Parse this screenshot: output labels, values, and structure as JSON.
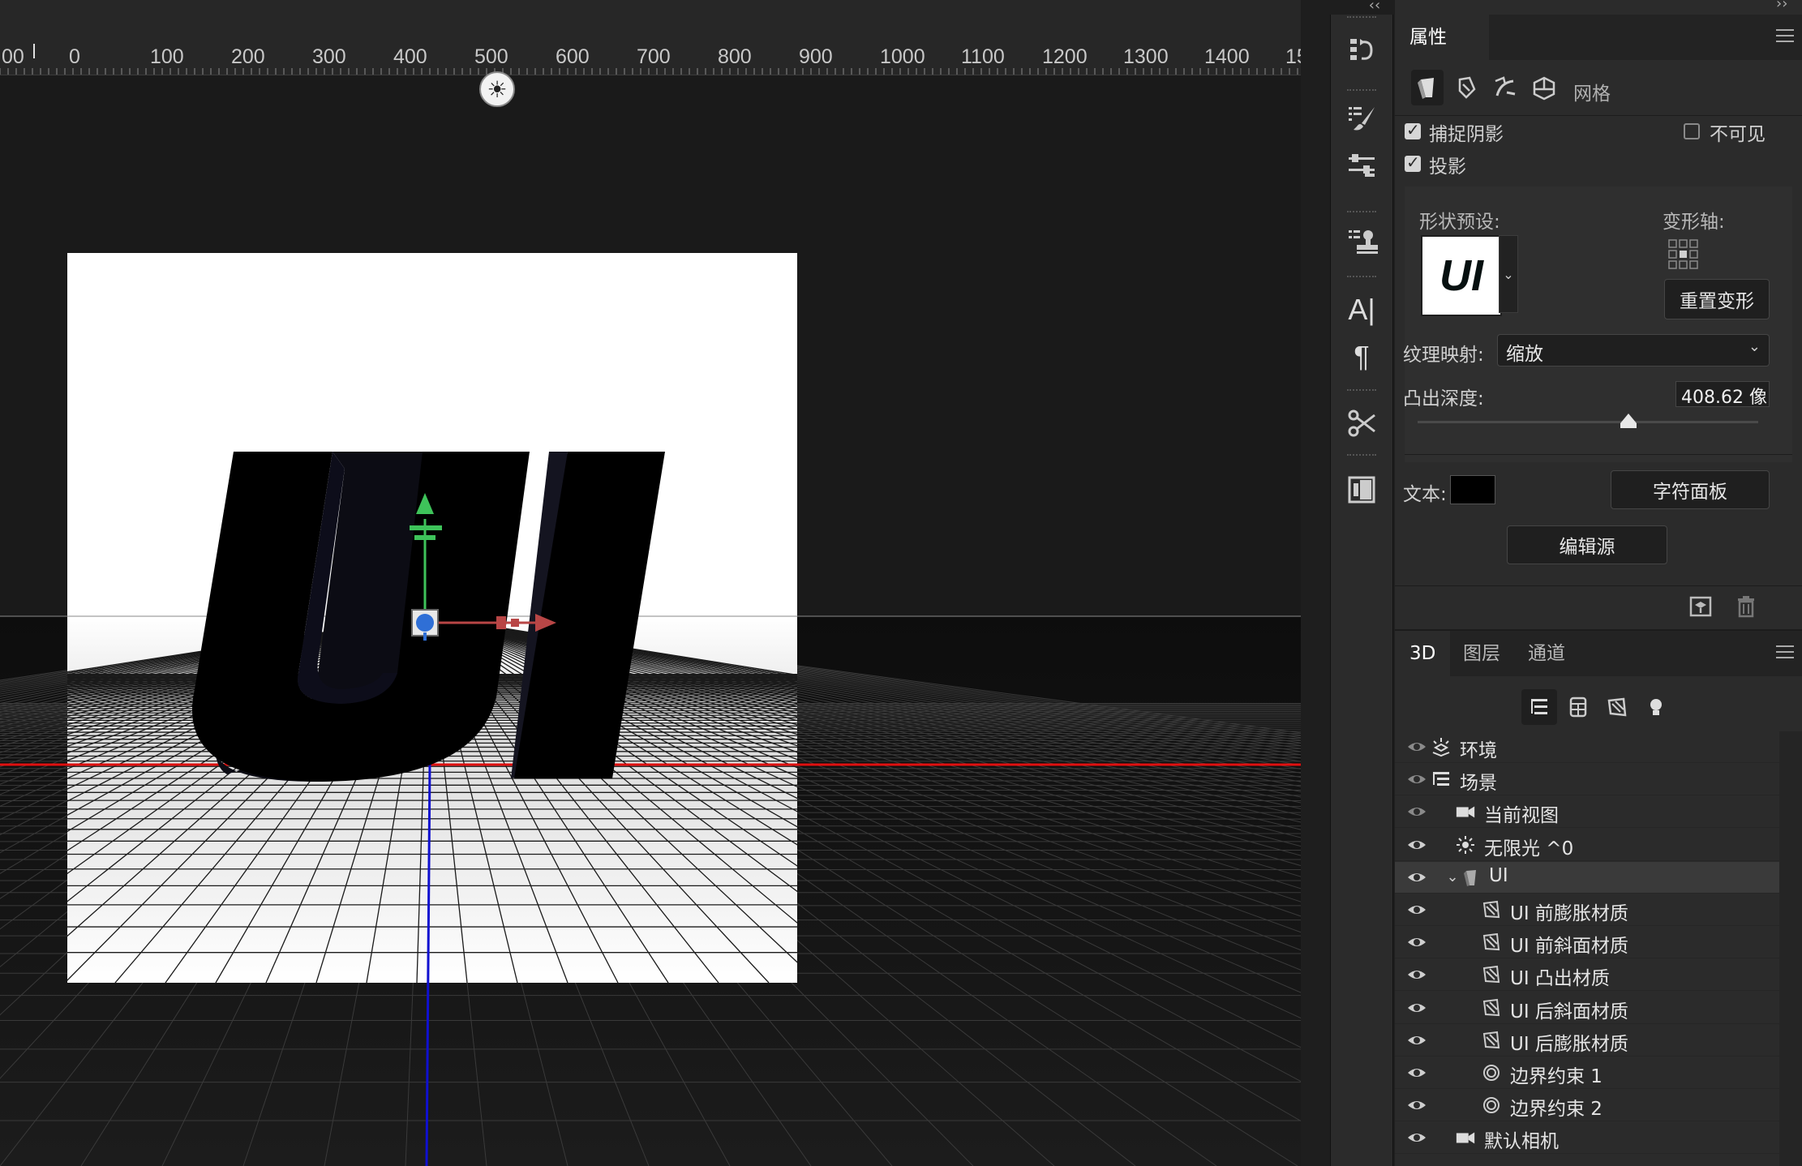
{
  "ruler": {
    "labels": [
      "00",
      "0",
      "100",
      "200",
      "300",
      "400",
      "500",
      "600",
      "700",
      "800",
      "900",
      "1000",
      "1100",
      "1200",
      "1300",
      "1400",
      "15"
    ]
  },
  "scene": {
    "text_3d": "UI",
    "colors": {
      "horizon_red": "#e01010",
      "vertical_blue": "#1010d0",
      "gizmo_green": "#3ec35a",
      "gizmo_red": "#b84646",
      "gizmo_blue": "#2f6fd6"
    }
  },
  "toolstrip": {
    "collapse_left": "‹‹",
    "tools": [
      "history-brush-icon",
      "brush-presets-icon",
      "adjust-sliders-icon",
      "clone-source-icon",
      "character-icon",
      "paragraph-icon",
      "3d-tools-icon",
      "libraries-icon"
    ]
  },
  "properties": {
    "title": "属性",
    "collapse_right": "››",
    "mode_icons": [
      "mesh-icon",
      "deform-icon",
      "cap-icon",
      "coordinates-icon"
    ],
    "mode_label": "网格",
    "catch_shadows": {
      "label": "捕捉阴影",
      "checked": true
    },
    "invisible": {
      "label": "不可见",
      "checked": false
    },
    "cast_shadows": {
      "label": "投影",
      "checked": true
    },
    "shape_preset_label": "形状预设:",
    "shape_preset_thumb": "UI",
    "deform_axis_label": "变形轴:",
    "reset_deform": "重置变形",
    "texture_mapping_label": "纹理映射:",
    "texture_mapping_value": "缩放",
    "extrusion_depth_label": "凸出深度:",
    "extrusion_depth_value": "408.62 像",
    "extrusion_slider_fraction": 0.62,
    "text_label": "文本:",
    "text_color": "#000000",
    "char_panel_button": "字符面板",
    "edit_source_button": "编辑源"
  },
  "layers_panel": {
    "tabs": [
      "3D",
      "图层",
      "通道"
    ],
    "active_tab": "3D",
    "filter_icons": [
      "scene-filter-icon",
      "mesh-filter-icon",
      "material-filter-icon",
      "light-filter-icon"
    ],
    "items": [
      {
        "label": "环境",
        "icon": "environment-icon",
        "indent": 0
      },
      {
        "label": "场景",
        "icon": "scene-icon",
        "indent": 0
      },
      {
        "label": "当前视图",
        "icon": "camera-icon",
        "indent": 1
      },
      {
        "label": "无限光 ^0",
        "icon": "infinite-light-icon",
        "indent": 1
      },
      {
        "label": "UI",
        "icon": "mesh-icon",
        "indent": 1,
        "selected": true,
        "expanded": true
      },
      {
        "label": "UI 前膨胀材质",
        "icon": "material-icon",
        "indent": 2
      },
      {
        "label": "UI 前斜面材质",
        "icon": "material-icon",
        "indent": 2
      },
      {
        "label": "UI 凸出材质",
        "icon": "material-icon",
        "indent": 2
      },
      {
        "label": "UI 后斜面材质",
        "icon": "material-icon",
        "indent": 2
      },
      {
        "label": "UI 后膨胀材质",
        "icon": "material-icon",
        "indent": 2
      },
      {
        "label": "边界约束 1",
        "icon": "constraint-icon",
        "indent": 2
      },
      {
        "label": "边界约束 2",
        "icon": "constraint-icon",
        "indent": 2
      },
      {
        "label": "默认相机",
        "icon": "camera-icon",
        "indent": 1
      }
    ]
  }
}
